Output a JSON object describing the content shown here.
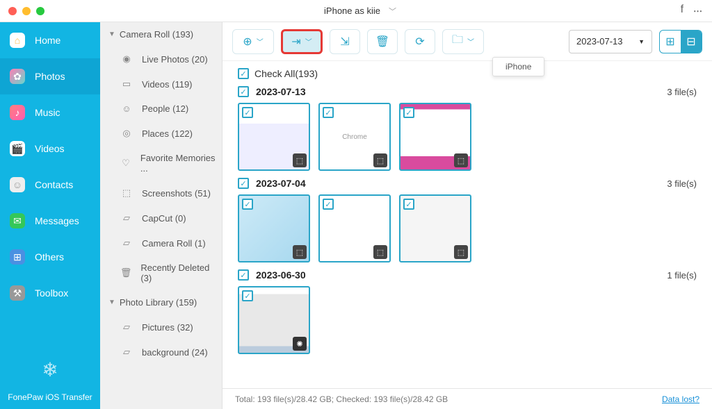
{
  "titlebar": {
    "device": "iPhone as kiie"
  },
  "nav": {
    "items": [
      {
        "label": "Home"
      },
      {
        "label": "Photos"
      },
      {
        "label": "Music"
      },
      {
        "label": "Videos"
      },
      {
        "label": "Contacts"
      },
      {
        "label": "Messages"
      },
      {
        "label": "Others"
      },
      {
        "label": "Toolbox"
      }
    ],
    "appname": "FonePaw iOS Transfer"
  },
  "albums": {
    "groups": [
      {
        "name": "Camera Roll (193)",
        "items": [
          {
            "label": "Live Photos (20)"
          },
          {
            "label": "Videos (119)"
          },
          {
            "label": "People (12)"
          },
          {
            "label": "Places (122)"
          },
          {
            "label": "Favorite Memories ..."
          },
          {
            "label": "Screenshots (51)"
          },
          {
            "label": "CapCut (0)"
          },
          {
            "label": "Camera Roll (1)"
          },
          {
            "label": "Recently Deleted (3)"
          }
        ]
      },
      {
        "name": "Photo Library (159)",
        "items": [
          {
            "label": "Pictures (32)"
          },
          {
            "label": "background (24)"
          }
        ]
      }
    ]
  },
  "toolbar": {
    "tooltip": "iPhone",
    "date": "2023-07-13"
  },
  "content": {
    "check_all": "Check All(193)",
    "sections": [
      {
        "date": "2023-07-13",
        "count": "3 file(s)"
      },
      {
        "date": "2023-07-04",
        "count": "3 file(s)"
      },
      {
        "date": "2023-06-30",
        "count": "1 file(s)"
      }
    ]
  },
  "status": {
    "text": "Total: 193 file(s)/28.42 GB; Checked: 193 file(s)/28.42 GB",
    "link": "Data lost?"
  }
}
